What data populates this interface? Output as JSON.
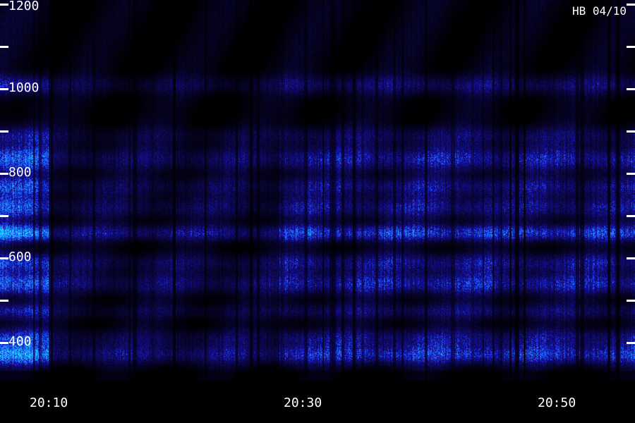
{
  "chart_data": {
    "type": "heatmap",
    "title": "",
    "xlabel": "",
    "ylabel": "",
    "station_label": "HB 04/10",
    "x_axis": {
      "range": [
        "20:06",
        "20:56"
      ],
      "minor_step_minutes": 5,
      "major_ticks": [
        "20:10",
        "20:30",
        "20:50"
      ]
    },
    "y_axis": {
      "range": [
        310,
        1210
      ],
      "minor_step": 100,
      "major_ticks": [
        400,
        600,
        800,
        1000,
        1200
      ]
    },
    "segments": [
      {
        "from": "20:06",
        "to": "20:10",
        "intensity": 0.85
      },
      {
        "from": "20:10",
        "to": "20:28",
        "intensity": 0.35
      },
      {
        "from": "20:28",
        "to": "20:56",
        "intensity": 0.55
      }
    ],
    "bands": [
      {
        "center": 372,
        "width": 14,
        "strength": 0.85
      },
      {
        "center": 412,
        "width": 14,
        "strength": 0.55
      },
      {
        "center": 475,
        "width": 12,
        "strength": 0.45
      },
      {
        "center": 540,
        "width": 16,
        "strength": 0.75
      },
      {
        "center": 590,
        "width": 14,
        "strength": 0.6
      },
      {
        "center": 660,
        "width": 12,
        "strength": 0.95
      },
      {
        "center": 720,
        "width": 16,
        "strength": 0.6
      },
      {
        "center": 770,
        "width": 14,
        "strength": 0.55
      },
      {
        "center": 835,
        "width": 18,
        "strength": 0.7
      },
      {
        "center": 890,
        "width": 14,
        "strength": 0.4
      },
      {
        "center": 1010,
        "width": 14,
        "strength": 0.45
      }
    ],
    "colors": {
      "background": "#000000",
      "low": "#1a0a8c",
      "mid": "#1e3cff",
      "high": "#1ef0ff",
      "axis": "#ffffff"
    }
  }
}
